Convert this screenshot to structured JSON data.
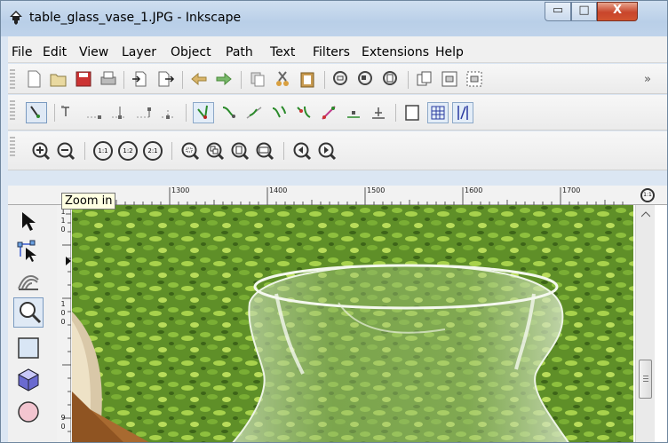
{
  "window": {
    "title": "table_glass_vase_1.JPG - Inkscape",
    "min_label": "▭",
    "max_label": "□",
    "close_label": "X"
  },
  "menu": [
    "File",
    "Edit",
    "View",
    "Layer",
    "Object",
    "Path",
    "Text",
    "Filters",
    "Extensions",
    "Help"
  ],
  "toolbar_commands": {
    "overflow_label": "»",
    "icons": [
      "new-icon",
      "open-icon",
      "save-icon",
      "print-icon",
      "import-icon",
      "export-icon",
      "undo-icon",
      "redo-icon",
      "copy-icon",
      "cut-icon",
      "paste-icon",
      "zoom-selection-icon",
      "zoom-drawing-icon",
      "zoom-page-icon",
      "duplicate-icon",
      "group-icon",
      "ungroup-icon"
    ]
  },
  "toolbar_node": {
    "icons": [
      "node-select-all-icon",
      "insert-node-icon",
      "delete-node-icon",
      "join-nodes-icon",
      "break-path-icon",
      "make-corner-icon",
      "make-smooth-icon",
      "make-symmetric-icon",
      "make-auto-smooth-icon",
      "make-line-icon",
      "make-curve-icon",
      "object-to-path-icon",
      "stroke-to-path-icon",
      "show-handles-icon",
      "show-outline-icon",
      "show-path-effect-icon"
    ]
  },
  "toolbar_zoom": {
    "icons": [
      "zoom-in-icon",
      "zoom-out-icon",
      "zoom-1-1-icon",
      "zoom-1-2-icon",
      "zoom-2-1-icon",
      "zoom-fit-selection-icon",
      "zoom-fit-drawing-icon",
      "zoom-fit-page-icon",
      "zoom-fit-width-icon",
      "zoom-previous-icon",
      "zoom-next-icon"
    ],
    "zoom_1_1": "1:1",
    "zoom_1_2": "1:2",
    "zoom_2_1": "2:1"
  },
  "tooltip": "Zoom in",
  "ruler": {
    "top_labels": [
      "1300",
      "1400",
      "1500",
      "1600",
      "1700"
    ],
    "left_labels_a": [
      "1",
      "1",
      "0"
    ],
    "left_labels_b": [
      "1",
      "0",
      "0"
    ],
    "left_labels_c": [
      "9",
      "0"
    ]
  },
  "toolbox": [
    "selector-tool-icon",
    "node-tool-icon",
    "tweak-tool-icon",
    "zoom-tool-icon",
    "rect-tool-icon",
    "3d-box-tool-icon",
    "ellipse-tool-icon"
  ],
  "corner_zoom_label": "1:1"
}
